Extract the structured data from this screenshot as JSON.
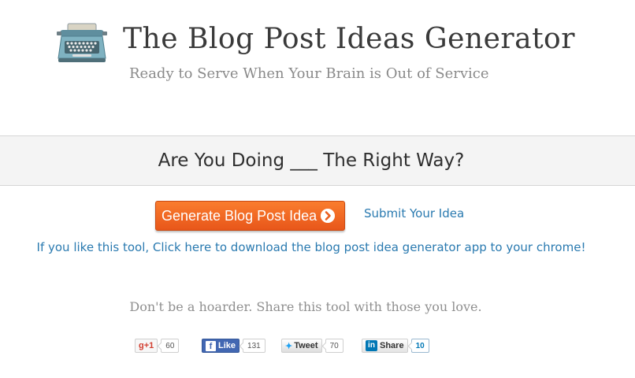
{
  "header": {
    "title": "The Blog Post Ideas Generator",
    "subtitle": "Ready to Serve When Your Brain is Out of Service",
    "logo_icon": "typewriter-icon"
  },
  "idea": {
    "text": "Are You Doing ___ The Right Way?"
  },
  "actions": {
    "generate_label": "Generate Blog Post Idea",
    "generate_icon": "chevron-right-circle-icon",
    "submit_label": "Submit Your Idea",
    "chrome_link": "If you like this tool, Click here to download the blog post idea generator app to your chrome!"
  },
  "share": {
    "prompt": "Don't be a hoarder. Share this tool with those you love.",
    "buttons": [
      {
        "network": "google-plus",
        "label": "+1",
        "count": "60"
      },
      {
        "network": "facebook",
        "label": "Like",
        "count": "131"
      },
      {
        "network": "twitter",
        "label": "Tweet",
        "count": "70"
      },
      {
        "network": "linkedin",
        "label": "Share",
        "count": "10"
      }
    ]
  },
  "colors": {
    "accent_orange": "#f26b22",
    "link_blue": "#2a7ab0",
    "band_gray": "#f4f4f4"
  }
}
